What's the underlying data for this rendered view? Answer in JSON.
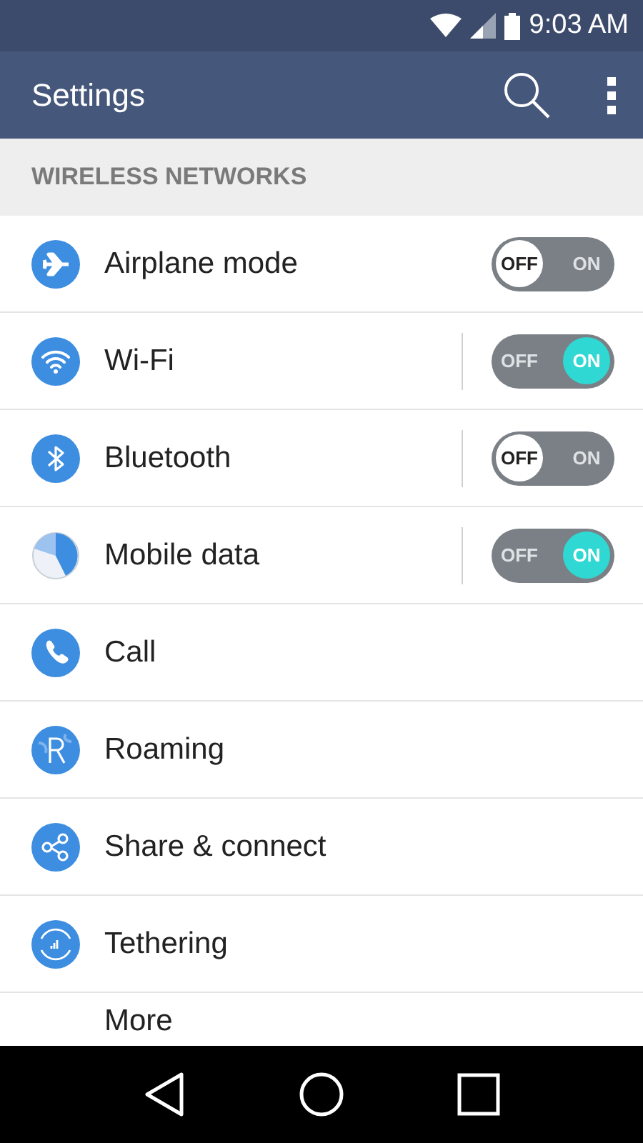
{
  "status_bar": {
    "time": "9:03 AM"
  },
  "app_bar": {
    "title": "Settings"
  },
  "section": {
    "title": "WIRELESS NETWORKS"
  },
  "items": [
    {
      "label": "Airplane mode",
      "kind": "toggle",
      "on": false,
      "divider": false,
      "off_text": "OFF",
      "on_text": "ON"
    },
    {
      "label": "Wi-Fi",
      "kind": "toggle",
      "on": true,
      "divider": true,
      "off_text": "OFF",
      "on_text": "ON"
    },
    {
      "label": "Bluetooth",
      "kind": "toggle",
      "on": false,
      "divider": true,
      "off_text": "OFF",
      "on_text": "ON"
    },
    {
      "label": "Mobile data",
      "kind": "toggle",
      "on": true,
      "divider": true,
      "off_text": "OFF",
      "on_text": "ON"
    },
    {
      "label": "Call",
      "kind": "link"
    },
    {
      "label": "Roaming",
      "kind": "link"
    },
    {
      "label": "Share & connect",
      "kind": "link"
    },
    {
      "label": "Tethering",
      "kind": "link"
    },
    {
      "label": "More",
      "kind": "plain"
    }
  ]
}
